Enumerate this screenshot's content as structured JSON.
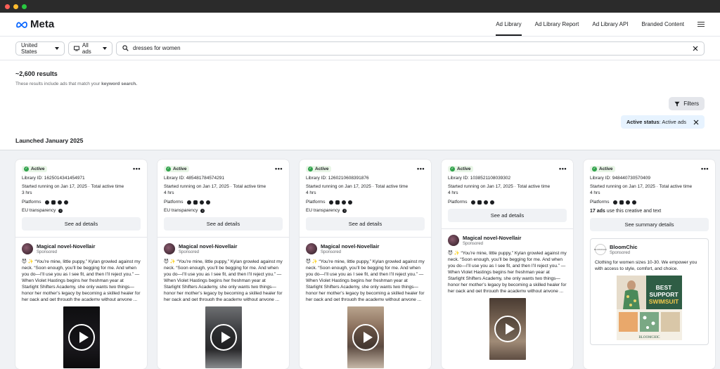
{
  "window": {
    "dots": [
      "#ff5f57",
      "#febc2e",
      "#28c840"
    ]
  },
  "brand": {
    "name": "Meta",
    "color": "#0866ff"
  },
  "nav": {
    "links": [
      "Ad Library",
      "Ad Library Report",
      "Ad Library API",
      "Branded Content"
    ]
  },
  "search": {
    "country": "United States",
    "ad_type": "All ads",
    "query": "dresses for women"
  },
  "results": {
    "count": "~2,600 results",
    "subtitle_prefix": "These results include ads that match your ",
    "subtitle_keyword": "keyword search.",
    "filters_label": "Filters",
    "status_label": "Active status",
    "status_value": ": Active ads",
    "launched": "Launched January 2025"
  },
  "cards": [
    {
      "status": "Active",
      "library_id": "Library ID: 1625014341454971",
      "started": "Started running on Jan 17, 2025 · Total active time",
      "duration": "3 hrs",
      "platforms": "Platforms",
      "eu": "EU transparency",
      "button": "See ad details",
      "advertiser": "Magical novel-Novellair",
      "sponsored": "Sponsored",
      "text": "😈 ✨ “You’re mine, little puppy,” Kylan growled against my neck. “Soon enough, you’ll be begging for me. And when you do—I’ll use you as I see fit, and then I’ll reject you.” — When Violet Hastings begins her freshman year at Starlight Shifters Academy, she only wants two things—honor her mother’s legacy by becoming a skilled healer for her pack and get through the academy without anyone ..."
    },
    {
      "status": "Active",
      "library_id": "Library ID: 485481784574291",
      "started": "Started running on Jan 17, 2025 · Total active time",
      "duration": "4 hrs",
      "platforms": "Platforms",
      "eu": "EU transparency",
      "button": "See ad details",
      "advertiser": "Magical novel-Novellair",
      "sponsored": "Sponsored",
      "text": "😈 ✨ “You’re mine, little puppy,” Kylan growled against my neck. “Soon enough, you’ll be begging for me. And when you do—I’ll use you as I see fit, and then I’ll reject you.” — When Violet Hastings begins her freshman year at Starlight Shifters Academy, she only wants two things—honor her mother’s legacy by becoming a skilled healer for her pack and get through the academy without anyone ..."
    },
    {
      "status": "Active",
      "library_id": "Library ID: 1260210608391876",
      "started": "Started running on Jan 17, 2025 · Total active time",
      "duration": "4 hrs",
      "platforms": "Platforms",
      "eu": "EU transparency",
      "button": "See ad details",
      "advertiser": "Magical novel-Novellair",
      "sponsored": "Sponsored",
      "text": "😈 ✨ “You’re mine, little puppy,” Kylan growled against my neck. “Soon enough, you’ll be begging for me. And when you do—I’ll use you as I see fit, and then I’ll reject you.” — When Violet Hastings begins her freshman year at Starlight Shifters Academy, she only wants two things—honor her mother’s legacy by becoming a skilled healer for her pack and get through the academy without anyone ..."
    },
    {
      "status": "Active",
      "library_id": "Library ID: 1038521108039302",
      "started": "Started running on Jan 17, 2025 · Total active time",
      "duration": "4 hrs",
      "platforms": "Platforms",
      "button": "See ad details",
      "advertiser": "Magical novel-Novellair",
      "sponsored": "Sponsored",
      "text": "😈 ✨ “You’re mine, little puppy,” Kylan growled against my neck. “Soon enough, you’ll be begging for me. And when you do—I’ll use you as I see fit, and then I’ll reject you.” — When Violet Hastings begins her freshman year at Starlight Shifters Academy, she only wants two things—honor her mother’s legacy by becoming a skilled healer for her pack and get through the academy without anyone ..."
    },
    {
      "status": "Active",
      "library_id": "Library ID: 948440730570409",
      "started": "Started running on Jan 17, 2025 · Total active time",
      "duration": "4 hrs",
      "platforms": "Platforms",
      "summary_count": "17 ads",
      "summary_rest": " use this creative and text",
      "button": "See summary details",
      "advertiser": "BloomChic",
      "sponsored": "Sponsored",
      "text": "Clothing for women sizes 10-30. We empower you with access to style, comfort, and choice.",
      "logo_text": "BLOOMCHIC",
      "creative_headline_1": "BEST",
      "creative_headline_2": "SUPPORT",
      "creative_headline_3": "SWIMSUIT",
      "creative_brand": "BLOOMCHIC"
    }
  ],
  "colors": {
    "active_green": "#31a24c",
    "chip_bg": "#e7f3ff",
    "button_bg": "#f0f2f5"
  }
}
